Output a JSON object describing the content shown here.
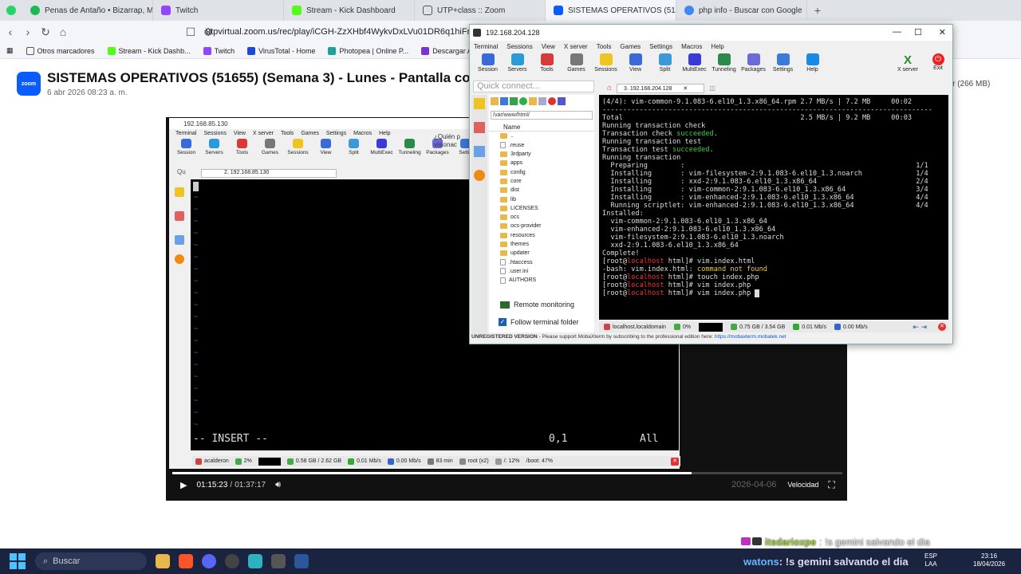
{
  "browser": {
    "tabs": [
      {
        "label": "Penas de Antaño • Bizarrap, Milo",
        "color": "#1db954"
      },
      {
        "label": "Twitch",
        "color": "#9146ff"
      },
      {
        "label": "Stream - Kick Dashboard",
        "color": "#53fc18"
      },
      {
        "label": "UTP+class :: Zoom",
        "color": "#555555"
      },
      {
        "label": "SISTEMAS OPERATIVOS (51655)",
        "color": "#0b5cff"
      },
      {
        "label": "php info - Buscar con Google",
        "color": "#4285f4"
      }
    ],
    "url": "utpvirtual.zoom.us/rec/play/iCGH-ZzXHbf4WykvDxLVu01DR6q1hiFrECUI1psMC",
    "bookmarks": [
      "Otros marcadores",
      "Stream - Kick Dashb...",
      "Twitch",
      "VirusTotal - Home",
      "Photopea | Online P...",
      "Descargar Audio de..."
    ]
  },
  "page": {
    "logo": "zoom",
    "title": "SISTEMAS OPERATIVOS (51655) (Semana 3) - Lunes - Pantalla compart",
    "date": "6 abr 2026 08:23 a. m.",
    "download": "gar (266 MB)"
  },
  "inner": {
    "title": "192.168.85.130",
    "menu": [
      "Terminal",
      "Sessions",
      "View",
      "X server",
      "Tools",
      "Games",
      "Settings",
      "Macros",
      "Help"
    ],
    "tools": [
      "Session",
      "Servers",
      "Tools",
      "Games",
      "Sessions",
      "View",
      "Split",
      "MultiExec",
      "Tunneling",
      "Packages",
      "Settin"
    ],
    "tab": "2. 192.168.85.130",
    "quick": "Qu",
    "promo": "¿Quién p visionac",
    "insert": "-- INSERT --",
    "pos": "0,1",
    "all": "All",
    "status": [
      "acalderon",
      "2%",
      "0.58 GB / 2.62 GB",
      "0.01 Mb/s",
      "0.00 Mb/s",
      "83 min",
      "root (x2)",
      "/: 12%",
      "/boot: 47%"
    ]
  },
  "player": {
    "time": "01:15:23",
    "duration": "01:37:17",
    "progress": 0.775,
    "speed": "Velocidad",
    "date_overlay": "2026-04-06"
  },
  "moba": {
    "title": "192.168.204.128",
    "menu": [
      "Terminal",
      "Sessions",
      "View",
      "X server",
      "Tools",
      "Games",
      "Settings",
      "Macros",
      "Help"
    ],
    "tools": [
      "Session",
      "Servers",
      "Tools",
      "Games",
      "Sessions",
      "View",
      "Split",
      "MultiExec",
      "Tunneling",
      "Packages",
      "Settings",
      "Help"
    ],
    "xserver": "X server",
    "exit": "Exit",
    "quick": "Quick connect...",
    "tab": "3. 192.168.204.128",
    "path": "/var/www/html/",
    "col": "Name",
    "files": [
      "..",
      ".reuse",
      "3rdparty",
      "apps",
      "config",
      "core",
      "dist",
      "lib",
      "LICENSES",
      "ocs",
      "ocs-provider",
      "resources",
      "themes",
      "updater",
      ".htaccess",
      ".user.ini",
      "AUTHORS"
    ],
    "remote": "Remote monitoring",
    "follow": "Follow terminal folder",
    "status": [
      "localhost.localdomain",
      "0%",
      "0.75 GB / 3.54 GB",
      "0.01 Mb/s",
      "0.00 Mb/s"
    ],
    "unreg": "UNREGISTERED VERSION",
    "unreg_msg": " -  Please support MobaXterm by subscribing to the professional edition here: ",
    "unreg_link": "https://mobaxterm.mobatek.net"
  },
  "terminal": {
    "lines": [
      "(4/4): vim-common-9.1.083-6.el10_1.3.x86_64.rpm 2.7 MB/s | 7.2 MB     00:02",
      "--------------------------------------------------------------------------------",
      "Total                                           2.5 MB/s | 9.2 MB     00:03",
      "Running transaction check",
      "Transaction check succeeded.",
      "Running transaction test",
      "Transaction test succeeded.",
      "Running transaction",
      "  Preparing        :                                                        1/1",
      "  Installing       : vim-filesystem-2:9.1.083-6.el10_1.3.noarch             1/4",
      "  Installing       : xxd-2:9.1.083-6.el10_1.3.x86_64                        2/4",
      "  Installing       : vim-common-2:9.1.083-6.el10_1.3.x86_64                 3/4",
      "  Installing       : vim-enhanced-2:9.1.083-6.el10_1.3.x86_64               4/4",
      "  Running scriptlet: vim-enhanced-2:9.1.083-6.el10_1.3.x86_64               4/4",
      "",
      "Installed:",
      "  vim-common-2:9.1.083-6.el10_1.3.x86_64",
      "  vim-enhanced-2:9.1.083-6.el10_1.3.x86_64",
      "  vim-filesystem-2:9.1.083-6.el10_1.3.noarch",
      "  xxd-2:9.1.083-6.el10_1.3.x86_64",
      "",
      "Complete!",
      "[root@localhost html]# vim.index.html",
      "-bash: vim.index.html: command not found",
      "[root@localhost html]# touch index.php",
      "[root@localhost html]# vim index.php",
      "[root@localhost html]# vim index.php "
    ]
  },
  "chat": {
    "overlay": "!s gemini salvando el dia",
    "overlay_user": "itsdarioxpe",
    "bottom_user": "watons",
    "bottom": ": !s gemini salvando el dia"
  },
  "taskbar": {
    "search": "Buscar",
    "lang": "ESP",
    "lang2": "LAA",
    "time": "23:16",
    "date": "18/04/2026"
  }
}
